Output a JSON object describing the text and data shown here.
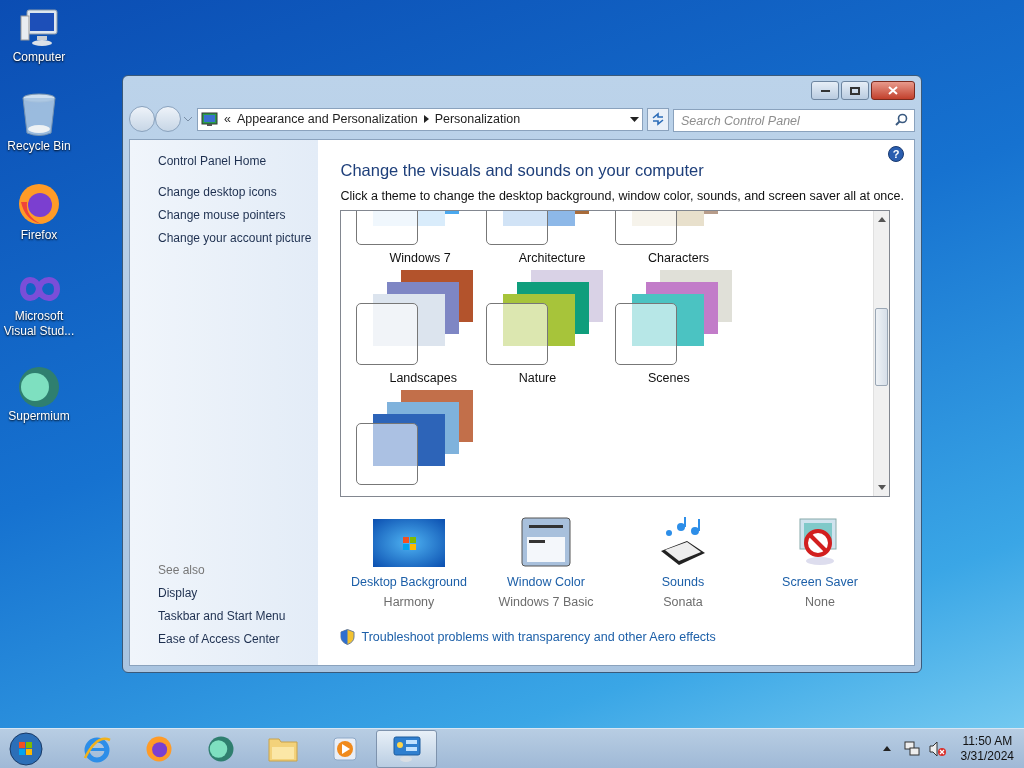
{
  "desktop_icons": [
    {
      "kind": "computer",
      "label": "Computer"
    },
    {
      "kind": "recycle",
      "label": "Recycle Bin"
    },
    {
      "kind": "firefox",
      "label": "Firefox"
    },
    {
      "kind": "vs",
      "label": "Microsoft Visual Stud..."
    },
    {
      "kind": "supermium",
      "label": "Supermium"
    }
  ],
  "window": {
    "breadcrumb": [
      "«",
      "Appearance and Personalization",
      "Personalization"
    ],
    "search": {
      "placeholder": "Search Control Panel"
    },
    "sidebar": {
      "home": "Control Panel Home",
      "links": [
        "Change desktop icons",
        "Change mouse pointers",
        "Change your account picture"
      ],
      "see_also": {
        "title": "See also",
        "links": [
          "Display",
          "Taskbar and Start Menu",
          "Ease of Access Center"
        ]
      }
    },
    "heading": "Change the visuals and sounds on your computer",
    "description": "Click a theme to change the desktop background, window color, sounds, and screen saver all at once.",
    "help": "?",
    "themes": [
      {
        "kind": "labeled",
        "name": "Windows 7"
      },
      {
        "kind": "labeled",
        "name": "Architecture"
      },
      {
        "kind": "labeled",
        "name": "Characters"
      },
      {
        "kind": "labeled",
        "name": "Landscapes"
      },
      {
        "kind": "labeled",
        "name": "Nature"
      },
      {
        "kind": "labeled",
        "name": "Scenes"
      },
      {
        "kind": "label_below_view"
      }
    ],
    "settings": [
      {
        "kind": "background",
        "label": "Desktop Background",
        "value": "Harmony"
      },
      {
        "kind": "color",
        "label": "Window Color",
        "value": "Windows 7 Basic"
      },
      {
        "kind": "sounds",
        "label": "Sounds",
        "value": "Sonata"
      },
      {
        "kind": "screensaver",
        "label": "Screen Saver",
        "value": "None"
      }
    ],
    "troubleshoot": "Troubleshoot problems with transparency and other Aero effects"
  },
  "taskbar": {
    "items": [
      {
        "kind": "ie",
        "selected": false
      },
      {
        "kind": "firefox",
        "selected": false
      },
      {
        "kind": "supermium",
        "selected": false
      },
      {
        "kind": "explorer",
        "selected": false
      },
      {
        "kind": "media",
        "selected": false
      },
      {
        "kind": "controlpanel",
        "selected": true
      }
    ],
    "time": "11:50 AM",
    "date": "3/31/2024"
  }
}
